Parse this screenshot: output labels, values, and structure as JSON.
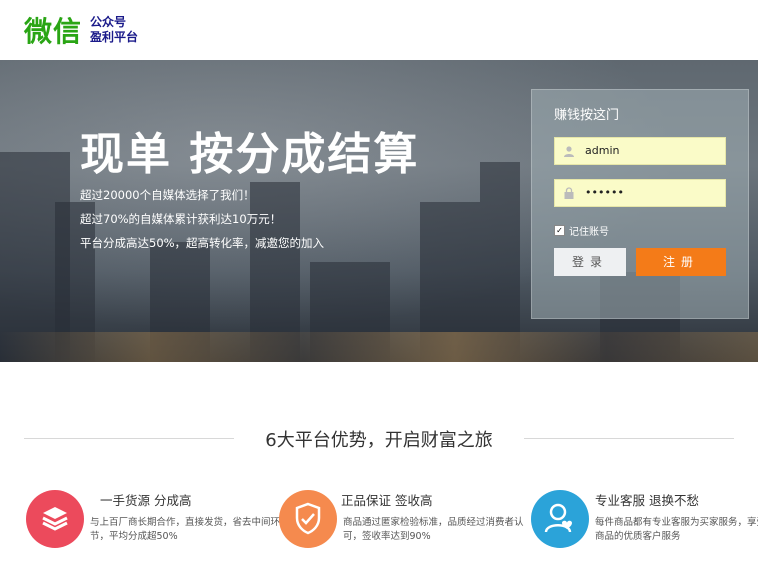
{
  "header": {
    "logo_main": "微信",
    "logo_sub_1": "公众号",
    "logo_sub_2": "盈利平台"
  },
  "hero": {
    "title": "现单 按分成结算",
    "lines": [
      "超过20000个自媒体选择了我们！",
      "超过70%的自媒体累计获利达10万元！",
      "平台分成高达50%，超高转化率，减邀您的加入"
    ]
  },
  "login": {
    "title": "赚钱按这门",
    "username_value": "admin",
    "password_value": "••••••",
    "remember_label": "记住账号",
    "login_label": "登录",
    "register_label": "注册"
  },
  "section": {
    "title": "6大平台优势，开启财富之旅"
  },
  "features": [
    {
      "head": "一手货源 分成高",
      "desc": "与上百厂商长期合作，直接发货，省去中间环节，平均分成超50%",
      "icon": "layers-icon",
      "color": "#ec4a5c"
    },
    {
      "head": "正品保证 签收高",
      "desc": "商品通过匿家检验标准，品质经过消费者认可，签收率达到90%",
      "icon": "shield-icon",
      "color": "#f58a4e"
    },
    {
      "head": "专业客服 退换不愁",
      "desc": "每件商品都有专业客服为买家服务，享受名人商品的优质客户服务",
      "icon": "user-heart-icon",
      "color": "#2ba3d9"
    }
  ]
}
